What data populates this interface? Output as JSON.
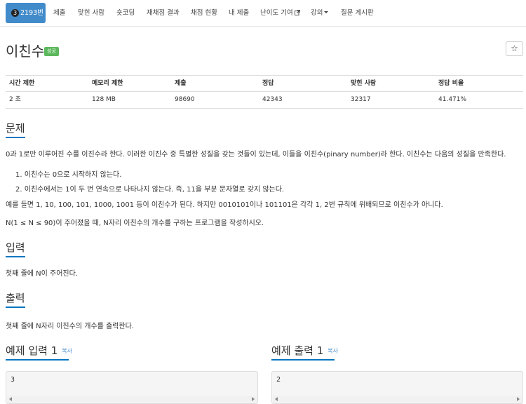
{
  "nav": {
    "items": [
      {
        "label": "2193번",
        "badge": "3",
        "active": true
      },
      {
        "label": "제출"
      },
      {
        "label": "맞힌 사람"
      },
      {
        "label": "숏코딩"
      },
      {
        "label": "재채점 결과"
      },
      {
        "label": "채점 현황"
      },
      {
        "label": "내 제출"
      },
      {
        "label": "난이도 기여"
      },
      {
        "label": "강의"
      },
      {
        "label": "질문 게시판"
      }
    ]
  },
  "problem": {
    "title": "이친수",
    "status_badge": "성공",
    "star_icon": "☆"
  },
  "info_table": {
    "headers": [
      "시간 제한",
      "메모리 제한",
      "제출",
      "정답",
      "맞힌 사람",
      "정답 비율"
    ],
    "values": [
      "2 초",
      "128 MB",
      "98690",
      "42343",
      "32317",
      "41.471%"
    ]
  },
  "sections": {
    "problem_title": "문제",
    "problem_paragraph_1": "0과 1로만 이루어진 수를 이진수라 한다. 이러한 이진수 중 특별한 성질을 갖는 것들이 있는데, 이들을 이친수(pinary number)라 한다. 이친수는 다음의 성질을 만족한다.",
    "problem_list": [
      "이친수는 0으로 시작하지 않는다.",
      "이친수에서는 1이 두 번 연속으로 나타나지 않는다. 즉, 11을 부분 문자열로 갖지 않는다."
    ],
    "problem_paragraph_2": "예를 들면 1, 10, 100, 101, 1000, 1001 등이 이친수가 된다. 하지만 0010101이나 101101은 각각 1, 2번 규칙에 위배되므로 이친수가 아니다.",
    "problem_paragraph_3": "N(1 ≤ N ≤ 90)이 주어졌을 때, N자리 이친수의 개수를 구하는 프로그램을 작성하시오.",
    "input_title": "입력",
    "input_text": "첫째 줄에 N이 주어진다.",
    "output_title": "출력",
    "output_text": "첫째 줄에 N자리 이친수의 개수를 출력한다."
  },
  "samples": {
    "input_title": "예제 입력 1",
    "output_title": "예제 출력 1",
    "copy_label": "복사",
    "input_value": "3",
    "output_value": "2"
  }
}
